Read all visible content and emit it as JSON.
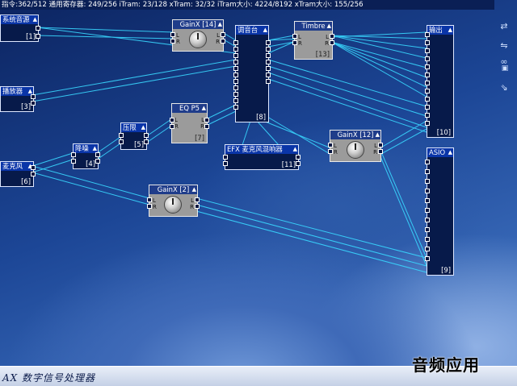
{
  "status_bar": {
    "text": "指令:362/512 通用寄存器: 249/256 iTram: 23/128 xTram: 32/32 iTram大小: 4224/8192 xTram大小: 155/256"
  },
  "modules": {
    "system_audio": {
      "title": "系统音源",
      "index": "[1]"
    },
    "player": {
      "title": "播放器",
      "index": "[3]"
    },
    "mic": {
      "title": "麦克风",
      "index": "[6]"
    },
    "noise_reduction": {
      "title": "降噪",
      "index": "[4]"
    },
    "limiter": {
      "title": "压限",
      "index": "[5]"
    },
    "eq": {
      "title": "EQ P5",
      "index": "[7]"
    },
    "gain14": {
      "title": "GainX [14]"
    },
    "gain12": {
      "title": "GainX [12]"
    },
    "gain2": {
      "title": "GainX [2]"
    },
    "mixer": {
      "title": "调音台",
      "index": "[8]"
    },
    "timbre": {
      "title": "Timbre",
      "index": "[13]"
    },
    "output": {
      "title": "输出",
      "index": "[10]"
    },
    "asio": {
      "title": "ASIO",
      "index": "[9]"
    },
    "efx": {
      "title": "EFX 麦克风混响器",
      "index": "[11]"
    }
  },
  "port_labels": {
    "left": "L",
    "right": "R"
  },
  "icons": {
    "title_arrow": "chevron-up-icon",
    "tool_icons": [
      "link-icon",
      "link-icon",
      "chain-icon",
      "save-icon",
      "open-icon"
    ]
  },
  "colors": {
    "wire": "#39d8ff",
    "node_bg": "#071a4a",
    "title_bg": "#0a35a8",
    "gain_bg": "#9b9b9b"
  },
  "bottom_bar": {
    "brand": "AX 数字信号处理器",
    "watermark": "音频应用"
  }
}
